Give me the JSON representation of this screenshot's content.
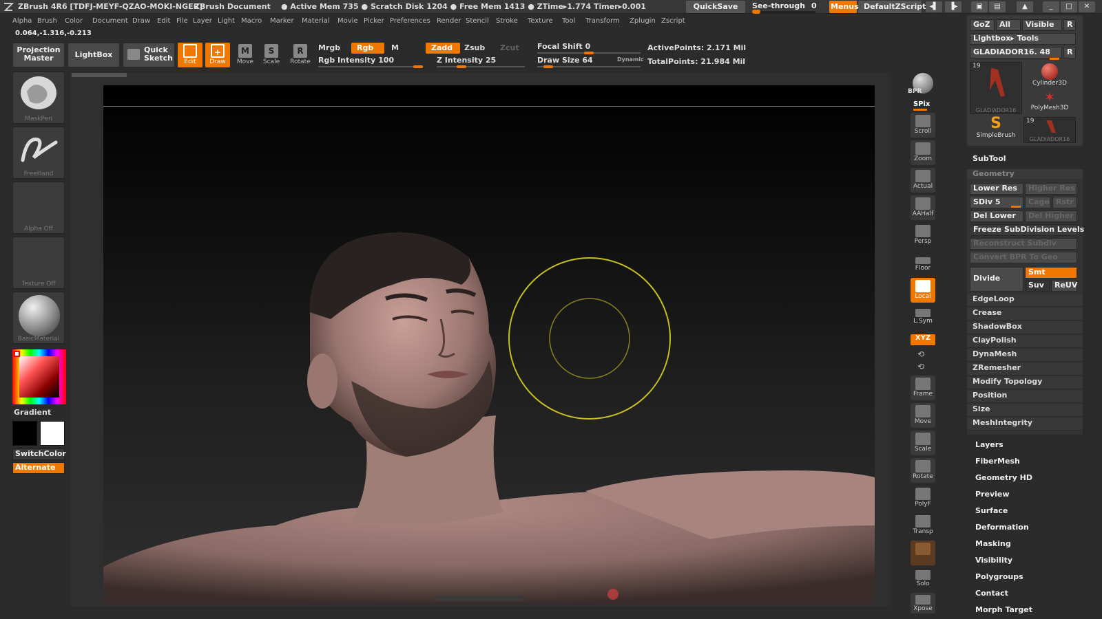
{
  "titlebar": {
    "app": "ZBrush 4R6 [TDFJ-MEYF-QZAO-MOKI-NGER]",
    "doc": "ZBrush Document",
    "status": "● Active Mem 735 ● Scratch Disk 1204 ● Free Mem 1413 ● ZTime▸1.774 Timer▸0.001",
    "quicksave": "QuickSave",
    "seethrough": "See-through",
    "seethrough_value": "0",
    "menus": "Menus",
    "script": "DefaultZScript"
  },
  "menubar": [
    "Alpha",
    "Brush",
    "Color",
    "Document",
    "Draw",
    "Edit",
    "File",
    "Layer",
    "Light",
    "Macro",
    "Marker",
    "Material",
    "Movie",
    "Picker",
    "Preferences",
    "Render",
    "Stencil",
    "Stroke",
    "Texture",
    "Tool",
    "Transform",
    "Zplugin",
    "Zscript"
  ],
  "coords": "0.064,-1.316,-0.213",
  "toolbar": {
    "projection": "Projection Master",
    "lightbox": "LightBox",
    "quicksketch": "Quick Sketch",
    "edit": "Edit",
    "draw": "Draw",
    "move": "Move",
    "scale": "Scale",
    "rotate": "Rotate",
    "mrgb": "Mrgb",
    "rgb": "Rgb",
    "m": "M",
    "zadd": "Zadd",
    "zsub": "Zsub",
    "zcut": "Zcut",
    "rgb_intensity": "Rgb Intensity 100",
    "rgb_intensity_value": 100,
    "z_intensity": "Z Intensity 25",
    "z_intensity_value": 25,
    "focal_shift": "Focal Shift 0",
    "focal_shift_value": 0,
    "draw_size": "Draw Size 64",
    "draw_size_value": 64,
    "dynamic": "Dynamic",
    "active_points": "ActivePoints: 2.171 Mil",
    "total_points": "TotalPoints: 21.984 Mil"
  },
  "left": {
    "maskpen": "MaskPen",
    "freehand": "FreeHand",
    "alpha": "Alpha Off",
    "texture": "Texture Off",
    "material": "BasicMaterial",
    "gradient": "Gradient",
    "switchcolor": "SwitchColor",
    "alternate": "Alternate"
  },
  "right_tools": [
    "BPR",
    "SPix",
    "Scroll",
    "Zoom",
    "Actual",
    "AAHalf",
    "Persp",
    "Floor",
    "Local",
    "L.Sym",
    "XYZ",
    "Frame",
    "Move",
    "Scale",
    "Rotate",
    "PolyF",
    "Transp",
    "Solo",
    "Xpose"
  ],
  "palette": {
    "goz": "GoZ",
    "all": "All",
    "visible": "Visible",
    "r": "R",
    "lightbox_tools": "Lightbox▸ Tools",
    "current_tool": "GLADIADOR16. 48",
    "thumb1": "GLADIADOR16",
    "thumb1_count": "19",
    "cylinder": "Cylinder3D",
    "polymesh": "PolyMesh3D",
    "simplebrush": "SimpleBrush",
    "thumb2": "GLADIADOR16",
    "thumb2_count": "19"
  },
  "subtool": "SubTool",
  "geometry": {
    "header": "Geometry",
    "lower_res": "Lower Res",
    "higher_res": "Higher Res",
    "sdiv": "SDiv 5",
    "cage": "Cage",
    "rstr": "Rstr",
    "del_lower": "Del Lower",
    "del_higher": "Del Higher",
    "freeze": "Freeze SubDivision Levels",
    "reconstruct": "Reconstruct Subdiv",
    "convert": "Convert BPR To Geo",
    "divide": "Divide",
    "smt": "Smt",
    "suv": "Suv",
    "reuv": "ReUV",
    "items": [
      "EdgeLoop",
      "Crease",
      "ShadowBox",
      "ClayPolish",
      "DynaMesh",
      "ZRemesher",
      "Modify Topology",
      "Position",
      "Size",
      "MeshIntegrity"
    ]
  },
  "tool_menus": [
    "Layers",
    "FiberMesh",
    "Geometry HD",
    "Preview",
    "Surface",
    "Deformation",
    "Masking",
    "Visibility",
    "Polygroups",
    "Contact",
    "Morph Target"
  ]
}
